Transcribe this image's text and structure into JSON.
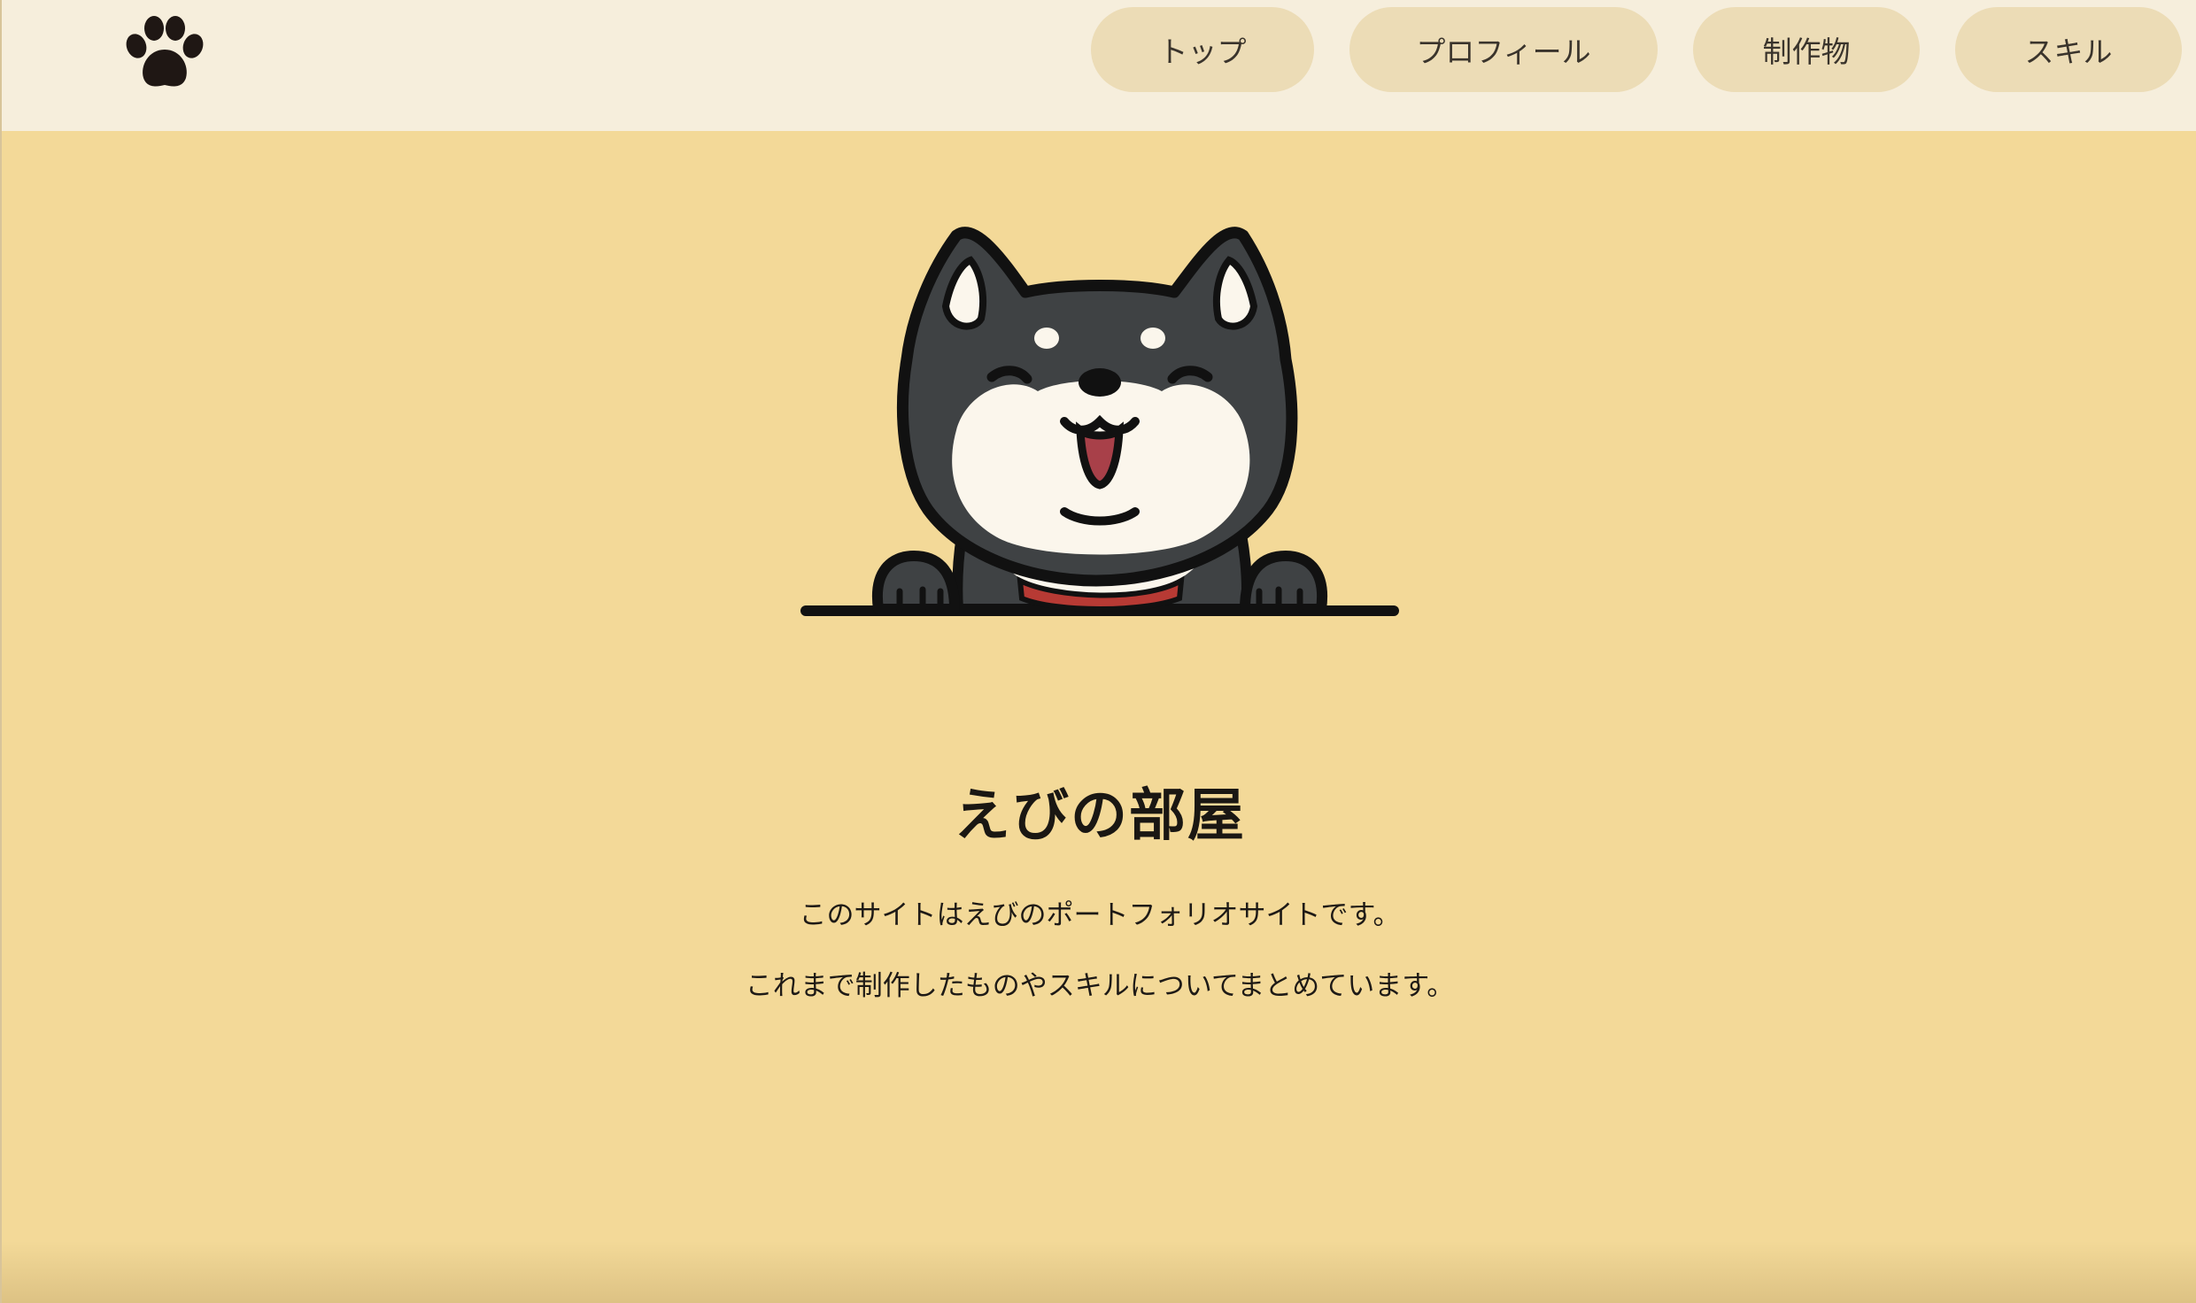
{
  "header": {
    "logo_icon": "paw-icon",
    "nav": [
      {
        "label": "トップ"
      },
      {
        "label": "プロフィール"
      },
      {
        "label": "制作物"
      },
      {
        "label": "スキル"
      }
    ]
  },
  "hero": {
    "illustration": "shiba-dog-icon",
    "title": "えびの部屋",
    "description": [
      "このサイトはえびのポートフォリオサイトです。",
      "これまで制作したものやスキルについてまとめています。"
    ]
  },
  "colors": {
    "background": "#f3d998",
    "header_background": "#f6eedc",
    "nav_button": "#ecdcb6",
    "text": "#1a1713"
  }
}
